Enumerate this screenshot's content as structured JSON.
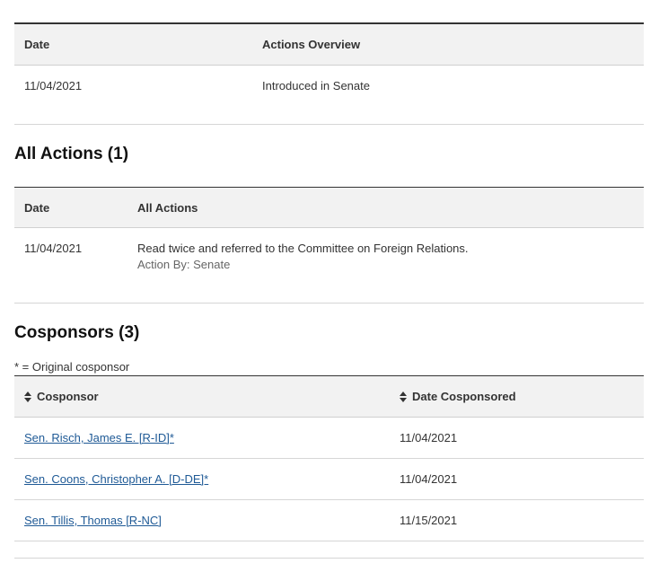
{
  "overview": {
    "headers": [
      "Date",
      "Actions Overview"
    ],
    "rows": [
      {
        "date": "11/04/2021",
        "action": "Introduced in Senate"
      }
    ]
  },
  "all_actions": {
    "title": "All Actions (1)",
    "headers": [
      "Date",
      "All Actions"
    ],
    "rows": [
      {
        "date": "11/04/2021",
        "action": "Read twice and referred to the Committee on Foreign Relations.",
        "action_by": "Action By: Senate"
      }
    ]
  },
  "cosponsors": {
    "title": "Cosponsors (3)",
    "note": "* = Original cosponsor",
    "headers": [
      "Cosponsor",
      "Date Cosponsored"
    ],
    "rows": [
      {
        "name": "Sen. Risch, James E. [R-ID]*",
        "date": "11/04/2021"
      },
      {
        "name": "Sen. Coons, Christopher A. [D-DE]*",
        "date": "11/04/2021"
      },
      {
        "name": "Sen. Tillis, Thomas [R-NC]",
        "date": "11/15/2021"
      }
    ]
  },
  "colors": {
    "link": "#1f5a96",
    "header_bg": "#f2f2f2"
  },
  "icons": {
    "sort": "sort-updown-icon"
  }
}
